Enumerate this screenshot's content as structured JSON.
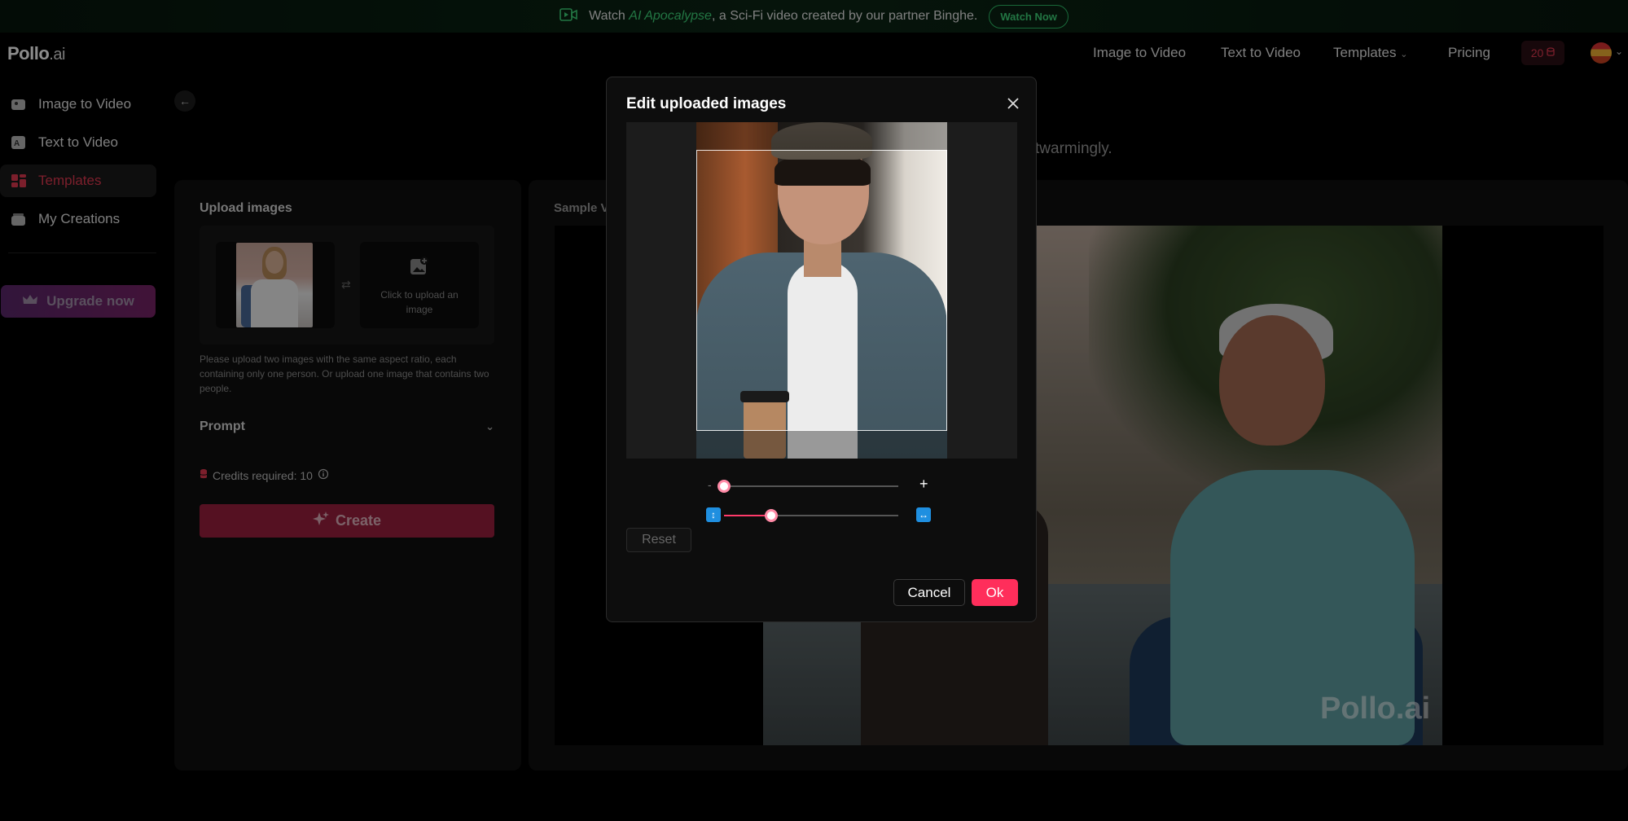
{
  "announcement": {
    "prefix": "Watch",
    "highlight": "AI Apocalypse",
    "suffix": ", a Sci-Fi video created by our partner Binghe.",
    "cta": "Watch Now"
  },
  "header": {
    "logo_main": "Pollo",
    "logo_suffix": ".ai",
    "nav": [
      "Image to Video",
      "Text to Video",
      "Templates",
      "Pricing"
    ],
    "credits": "20"
  },
  "sidebar": {
    "items": [
      {
        "label": "Image to Video",
        "icon": "image-video-icon"
      },
      {
        "label": "Text to Video",
        "icon": "text-video-icon"
      },
      {
        "label": "Templates",
        "icon": "templates-icon"
      },
      {
        "label": "My Creations",
        "icon": "creations-icon"
      }
    ],
    "upgrade_label": "Upgrade now"
  },
  "background": {
    "description_fragment": "twarmingly."
  },
  "left_panel": {
    "title": "Upload images",
    "upload_placeholder": "Click to upload an image",
    "help_text": "Please upload two images with the same aspect ratio, each containing only one person. Or upload one image that contains two people.",
    "prompt_label": "Prompt",
    "credits_required": "Credits required: 10",
    "create_label": "Create"
  },
  "right_panel": {
    "sample_label": "Sample V",
    "watermark": "Pollo.ai"
  },
  "modal": {
    "title": "Edit uploaded images",
    "zoom_minus": "-",
    "zoom_plus": "+",
    "zoom_level": 0,
    "aspect_level": 0.27,
    "reset_label": "Reset",
    "cancel_label": "Cancel",
    "ok_label": "Ok"
  },
  "colors": {
    "accent": "#ff2e5b",
    "brand_green": "#3fd67a",
    "aspect_blue": "#1f8fe0"
  }
}
